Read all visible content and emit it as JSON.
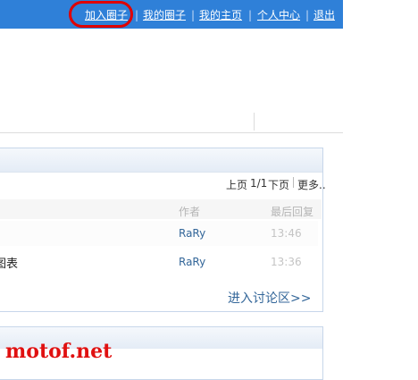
{
  "nav": {
    "join_circle": "加入圈子",
    "my_circles": "我的圈子",
    "my_homepage": "我的主页",
    "personal_center": "个人中心",
    "logout": "退出",
    "separator": "|"
  },
  "panel": {
    "pager": {
      "prev": "上页",
      "page_info": "1/1",
      "next": "下页",
      "more": "更多.."
    },
    "columns": {
      "author": "作者",
      "last_reply": "最后回复"
    },
    "rows": [
      {
        "title": "",
        "author": "RaRy",
        "time": "13:46"
      },
      {
        "title": "图表",
        "author": "RaRy",
        "time": "13:36"
      }
    ],
    "enter_discussion": "进入讨论区>>"
  },
  "watermark": "motof.net",
  "colors": {
    "topbar": "#2f80d8",
    "highlight": "#e00000",
    "link": "#336699",
    "watermark": "#e01010"
  }
}
